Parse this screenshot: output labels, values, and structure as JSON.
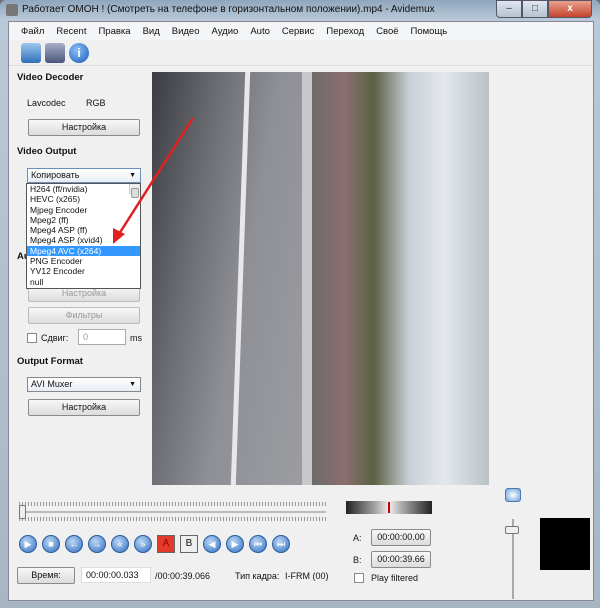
{
  "window": {
    "title": "Работает ОМОН ! (Смотреть на телефоне в горизонтальном положении).mp4 - Avidemux",
    "minimize": "–",
    "maximize": "□",
    "close": "x"
  },
  "menu": [
    "Файл",
    "Recent",
    "Правка",
    "Вид",
    "Видео",
    "Аудио",
    "Auto",
    "Сервис",
    "Переход",
    "Своё",
    "Помощь"
  ],
  "toolbar": {
    "icons": [
      "open-folder-icon",
      "save-icon",
      "info-icon"
    ]
  },
  "video_decoder": {
    "heading": "Video Decoder",
    "codec": "Lavcodec",
    "format": "RGB",
    "settings": "Настройка"
  },
  "video_output": {
    "heading": "Video Output",
    "selected": "Копировать",
    "options": [
      "H264 (ff/nvidia)",
      "HEVC (x265)",
      "Mjpeg Encoder",
      "Mpeg2 (ff)",
      "Mpeg4 ASP (ff)",
      "Mpeg4 ASP (xvid4)",
      "Mpeg4 AVC (x264)",
      "PNG Encoder",
      "YV12 Encoder",
      "null"
    ],
    "highlighted": "Mpeg4 AVC (x264)"
  },
  "audio_output": {
    "heading_partial": "Au",
    "settings": "Настройка",
    "filters": "Фильтры",
    "shift_label": "Сдвиг:",
    "shift_value": "0",
    "shift_unit": "ms"
  },
  "output_format": {
    "heading": "Output Format",
    "selected": "AVI Muxer",
    "settings": "Настройка"
  },
  "playback": {
    "buttons": [
      "play",
      "stop",
      "prev-frame",
      "next-frame",
      "prev-keyframe",
      "next-keyframe",
      "set-marker-a",
      "set-marker-b",
      "goto-marker-a",
      "goto-marker-b",
      "goto-start",
      "goto-end"
    ],
    "marker_a_label": "A",
    "marker_b_label": "B"
  },
  "status": {
    "time_button": "Время:",
    "current_time": "00:00:00.033",
    "total_time": "/00:00:39.066",
    "frame_type_label": "Тип кадра:",
    "frame_type": "I-FRM (00)"
  },
  "selection": {
    "a_label": "A:",
    "a_value": "00:00:00.00",
    "b_label": "B:",
    "b_value": "00:00:39.66",
    "play_filtered": "Play filtered"
  },
  "colors": {
    "highlight": "#3399ff",
    "annotation_arrow": "#e02020"
  }
}
